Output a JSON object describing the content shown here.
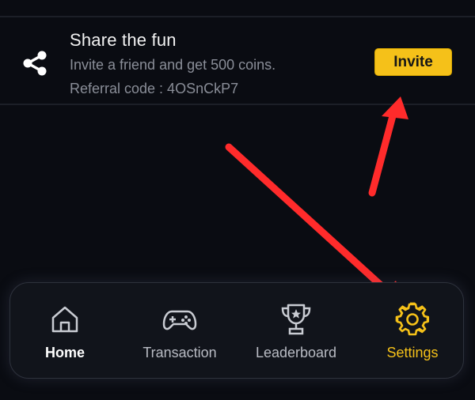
{
  "share_card": {
    "title": "Share the fun",
    "description": "Invite a friend and get 500 coins.",
    "referral_code": "Referral code : 4OSnCkP7",
    "invite_label": "Invite",
    "icon": "share-icon"
  },
  "bottom_nav": {
    "items": [
      {
        "label": "Home",
        "icon": "home-icon",
        "selected": true
      },
      {
        "label": "Transaction",
        "icon": "gamepad-icon",
        "selected": false
      },
      {
        "label": "Leaderboard",
        "icon": "trophy-icon",
        "selected": false
      },
      {
        "label": "Settings",
        "icon": "gear-icon",
        "selected": false
      }
    ]
  },
  "colors": {
    "background": "#0a0c12",
    "accent": "#f5c119",
    "arrow": "#ff2b2b",
    "nav_background": "#11141b"
  }
}
